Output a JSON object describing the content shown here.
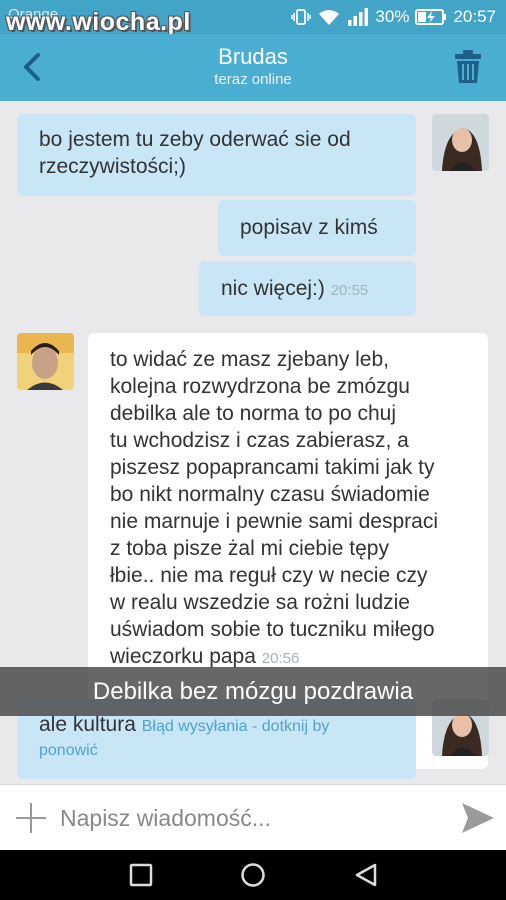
{
  "status_bar": {
    "carrier": "Orange",
    "watermark": "www.wiocha.pl",
    "battery": "30%",
    "time": "20:57",
    "icons": [
      "vibrate-icon",
      "wifi-icon",
      "signal-icon",
      "battery-charging-icon"
    ]
  },
  "header": {
    "contact_name": "Brudas",
    "presence": "teraz online",
    "icons": [
      "back-arrow-icon",
      "trash-icon"
    ]
  },
  "messages": [
    {
      "direction": "outgoing",
      "lines": [
        "bo jestem tu zeby oderwać sie od",
        "rzeczywistości;)"
      ]
    },
    {
      "direction": "outgoing",
      "lines": [
        "popisav z kimś"
      ]
    },
    {
      "direction": "outgoing",
      "lines": [
        "nic więcej:)"
      ],
      "time": "20:55"
    },
    {
      "direction": "incoming",
      "lines": [
        "to widać ze masz zjebany leb,",
        "kolejna rozwydrzona be zmózgu",
        "debilka ale to norma to po chuj",
        "tu wchodzisz i czas zabierasz, a",
        "piszesz popaprancami takimi jak ty",
        "bo nikt normalny czasu świadomie",
        "nie marnuje i pewnie sami despraci",
        "z toba pisze żal mi ciebie tępy",
        "łbie.. nie ma reguł czy  w necie czy",
        "w realu wszedzie sa rożni ludzie",
        "uświadom sobie to tuczniku miłego",
        "wieczorku papa"
      ],
      "time": "20:56"
    },
    {
      "direction": "outgoing",
      "text": "ale kultura",
      "error": "Błąd wysyłania - dotknij by",
      "error_cont": "ponowić"
    }
  ],
  "caption": "Debilka bez mózgu pozdrawia",
  "composer": {
    "placeholder": "Napisz wiadomość...",
    "icons": [
      "plus-icon",
      "send-icon"
    ]
  },
  "nav": {
    "icons": [
      "recent-apps-icon",
      "home-icon",
      "back-icon"
    ]
  },
  "colors": {
    "header": "#4aaed3",
    "outgoing_bubble": "#c9e6f7",
    "incoming_bubble": "#ffffff",
    "background": "#e9e9ec"
  }
}
